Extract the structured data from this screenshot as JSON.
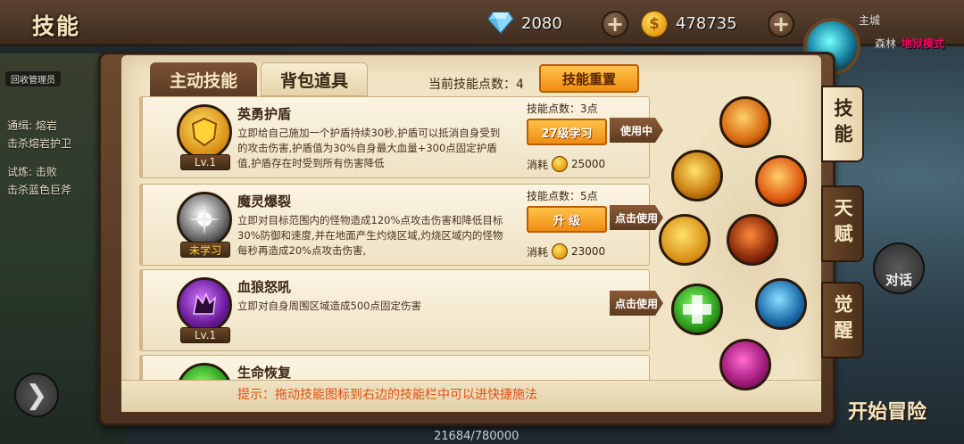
{
  "header": {
    "title": "技能",
    "gems": "2080",
    "coins": "478735",
    "gold_symbol": "$",
    "top_right_main_city": "主城",
    "top_right_forest": "森林",
    "hard_mode": "地狱模式"
  },
  "left_scene": {
    "admin_label": "回收管理员",
    "quest1_title": "通缉: 熔岩",
    "quest1_desc": "击杀熔岩护卫",
    "quest2_title": "试炼: 击败",
    "quest2_desc": "击杀蓝色巨斧",
    "arrow": "❯"
  },
  "tabs": {
    "active_skills": "主动技能",
    "items": "背包道具"
  },
  "skill_points": {
    "label": "当前技能点数：",
    "value": "4",
    "reset_label": "技能重置"
  },
  "skills": [
    {
      "name": "英勇护盾",
      "desc": "立即给自己施加一个护盾持续30秒,护盾可以抵消自身受到的攻击伤害,护盾值为30%自身最大血量+300点固定护盾值,护盾存在时受到所有伤害降低",
      "cost_pts": "技能点数：3点",
      "button": "27级学习",
      "use_label": "使用中",
      "consume": "消耗",
      "coins": "25000",
      "badge": "Lv.1"
    },
    {
      "name": "魔灵爆裂",
      "desc": "立即对目标范围内的怪物造成120%点攻击伤害和降低目标30%防御和速度,并在地面产生灼烧区域,灼烧区域内的怪物每秒再造成20%点攻击伤害,",
      "cost_pts": "技能点数：5点",
      "button": "升 级",
      "use_label": "点击使用",
      "consume": "消耗",
      "coins": "23000",
      "badge": "未学习"
    },
    {
      "name": "血狼怒吼",
      "desc": "立即对自身周围区域造成500点固定伤害",
      "use_label": "点击使用",
      "badge": "Lv.1"
    },
    {
      "name": "生命恢复"
    }
  ],
  "hint": "提示：拖动技能图标到右边的技能栏中可以进快捷施法",
  "side_tabs": {
    "skills": "技能",
    "talent": "天赋",
    "awaken": "觉醒"
  },
  "right_scene": {
    "dialog": "对话",
    "start": "开始冒险",
    "exp": "21684/780000"
  }
}
